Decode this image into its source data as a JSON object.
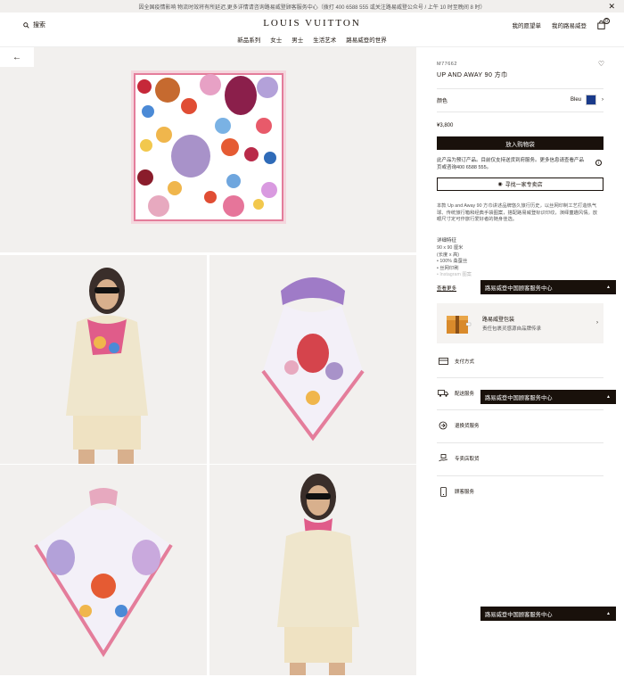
{
  "banner": {
    "text": "因全国疫情影响 物流时效将有所延迟,更多详情请咨询路易威登顾客服务中心（拨打 400 6588 555 或关注路易威登公众号 / 上午 10 时至晚间 8 时）",
    "close_glyph": "✕"
  },
  "header": {
    "search_label": "搜索",
    "logo": "LOUIS VUITTON",
    "account_label": "我的愿望单",
    "my_lv_label": "我的路易威登",
    "cart_count": "0",
    "nav": [
      "新品系列",
      "女士",
      "男士",
      "生活艺术",
      "路易威登的世界"
    ]
  },
  "gallery": {
    "back_glyph": "←"
  },
  "product": {
    "sku": "M77662",
    "title": "UP AND AWAY 90 方巾",
    "heart_glyph": "♡",
    "color_label": "颜色",
    "color_value": "Bleu",
    "color_chevron": "›",
    "price": "¥3,800",
    "add_to_cart": "放入购物袋",
    "preorder_text": "此产品为预订产品。目前仅支持送货到府服务。更多信息请查看产品页或咨询400 6588 555。",
    "info_glyph": "i",
    "store_button": "寻找一家专卖店",
    "pin_glyph": "◉",
    "description": "本款 Up and Away 90 方巾讲述品牌悠久旅行历史，以丝网印制工艺打造热气球、传统旅行箱和经典手袋图案，搭配路易威登标识印纹，演绎童趣风情。放眼尺寸定可作旅行爱好者的随身佳选。",
    "detail_heading": "详细特征",
    "detail_lines": [
      "90 x 90 厘米",
      "(长度 x 高)",
      "• 100% 桑蚕丝",
      "• 丝网印刷",
      "• Instagram 图案"
    ],
    "more_link": "查看更多",
    "service_bar_label": "路易威登中国顾客服务中心",
    "service_bar_caret": "▲",
    "packaging_title": "路易威登包装",
    "packaging_sub": "责任包裹灵感源自品牌传承",
    "packaging_arrow": "›",
    "services": [
      {
        "label": "支付方式"
      },
      {
        "label": "配送服务"
      },
      {
        "label": "退换货服务"
      },
      {
        "label": "专卖店取货"
      },
      {
        "label": "顾客服务"
      }
    ]
  },
  "colors": {
    "text": "#19110b",
    "dark": "#19110b",
    "swatch_bleu": "#1a3a8a",
    "tile_bg": "#f2f0ee"
  }
}
